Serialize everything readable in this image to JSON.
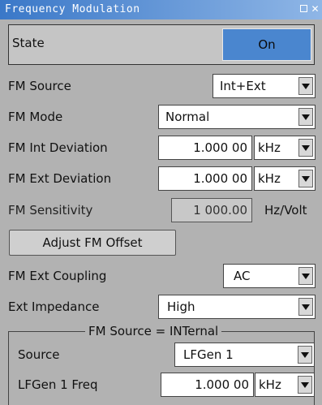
{
  "window": {
    "title": "Frequency Modulation"
  },
  "state": {
    "label": "State",
    "value": "On"
  },
  "fm_source": {
    "label": "FM Source",
    "value": "Int+Ext"
  },
  "fm_mode": {
    "label": "FM Mode",
    "value": "Normal"
  },
  "fm_int_deviation": {
    "label": "FM Int Deviation",
    "value": "1.000 00",
    "unit": "kHz"
  },
  "fm_ext_deviation": {
    "label": "FM Ext Deviation",
    "value": "1.000 00",
    "unit": "kHz"
  },
  "fm_sensitivity": {
    "label": "FM Sensitivity",
    "value": "1 000.00",
    "unit": "Hz/Volt"
  },
  "adjust_offset": {
    "label": "Adjust FM Offset"
  },
  "fm_ext_coupling": {
    "label": "FM Ext Coupling",
    "value": "AC"
  },
  "ext_impedance": {
    "label": "Ext Impedance",
    "value": "High"
  },
  "internal_group": {
    "legend": "FM Source = INTernal",
    "source": {
      "label": "Source",
      "value": "LFGen 1"
    },
    "lfgen_freq": {
      "label": "LFGen 1 Freq",
      "value": "1.000 00",
      "unit": "kHz"
    }
  },
  "icons": {
    "maximize": "maximize-icon",
    "close": "close-icon",
    "dropdown": "chevron-down-icon"
  }
}
